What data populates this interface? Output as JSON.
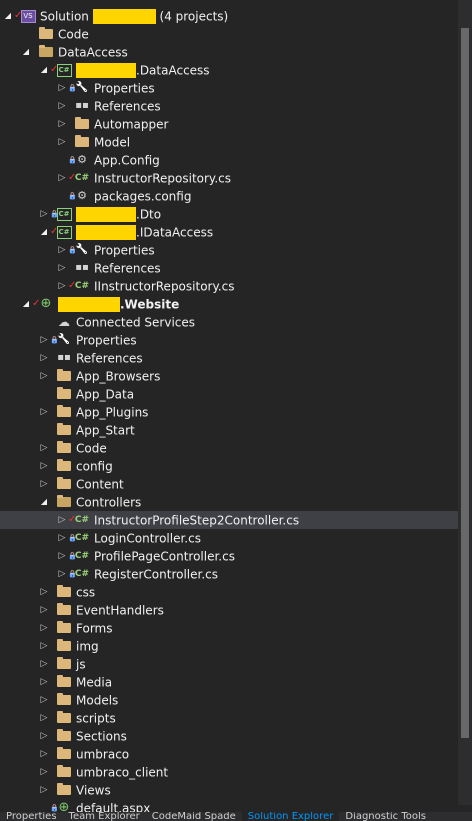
{
  "colors": {
    "background": "#252526",
    "selected_row": "#3f3f46",
    "folder": "#dcb67a",
    "csharp": "#9bd37a",
    "redaction": "#ffd500",
    "active_tab": "#0097fb"
  },
  "tree": [
    {
      "indent": 0,
      "expander": "open",
      "check": true,
      "icon": "solution-icon",
      "pre": "Solution",
      "redact_w": 63,
      "post": " (4 projects)"
    },
    {
      "indent": 1,
      "expander": "none",
      "icon": "folder-icon",
      "label": "Code"
    },
    {
      "indent": 1,
      "expander": "open",
      "icon": "folder-open-icon",
      "label": "DataAccess"
    },
    {
      "indent": 2,
      "expander": "open",
      "check": true,
      "icon": "csharp-project-icon",
      "redact_w": 60,
      "post": ".DataAccess"
    },
    {
      "indent": 3,
      "expander": "closed",
      "lock": true,
      "icon": "wrench-icon",
      "label": "Properties"
    },
    {
      "indent": 3,
      "expander": "closed",
      "icon": "references-icon",
      "label": "References"
    },
    {
      "indent": 3,
      "expander": "closed",
      "icon": "folder-icon",
      "label": "Automapper"
    },
    {
      "indent": 3,
      "expander": "closed",
      "icon": "folder-icon",
      "label": "Model"
    },
    {
      "indent": 3,
      "expander": "none",
      "lock": true,
      "icon": "config-file-icon",
      "label": "App.Config"
    },
    {
      "indent": 3,
      "expander": "closed",
      "check": true,
      "icon": "csharp-file-icon",
      "label": "InstructorRepository.cs"
    },
    {
      "indent": 3,
      "expander": "none",
      "lock": true,
      "icon": "config-file-icon",
      "label": "packages.config"
    },
    {
      "indent": 2,
      "expander": "closed",
      "lock": true,
      "icon": "csharp-project-icon",
      "redact_w": 60,
      "post": ".Dto"
    },
    {
      "indent": 2,
      "expander": "open",
      "check": true,
      "icon": "csharp-project-icon",
      "redact_w": 60,
      "post": ".IDataAccess"
    },
    {
      "indent": 3,
      "expander": "closed",
      "lock": true,
      "icon": "wrench-icon",
      "label": "Properties"
    },
    {
      "indent": 3,
      "expander": "closed",
      "icon": "references-icon",
      "label": "References"
    },
    {
      "indent": 3,
      "expander": "closed",
      "check": true,
      "icon": "csharp-file-icon",
      "label": "IInstructorRepository.cs"
    },
    {
      "indent": 1,
      "expander": "open",
      "check": true,
      "icon": "web-project-icon",
      "redact_w": 62,
      "post": ".Website",
      "bold": true
    },
    {
      "indent": 2,
      "expander": "none",
      "icon": "cloud-icon",
      "label": "Connected Services"
    },
    {
      "indent": 2,
      "expander": "closed",
      "lock": true,
      "icon": "wrench-icon",
      "label": "Properties"
    },
    {
      "indent": 2,
      "expander": "closed",
      "icon": "references-icon",
      "label": "References"
    },
    {
      "indent": 2,
      "expander": "closed",
      "icon": "folder-icon",
      "label": "App_Browsers"
    },
    {
      "indent": 2,
      "expander": "none",
      "icon": "folder-icon",
      "label": "App_Data"
    },
    {
      "indent": 2,
      "expander": "closed",
      "icon": "folder-icon",
      "label": "App_Plugins"
    },
    {
      "indent": 2,
      "expander": "none",
      "icon": "folder-icon",
      "label": "App_Start"
    },
    {
      "indent": 2,
      "expander": "closed",
      "icon": "folder-icon",
      "label": "Code"
    },
    {
      "indent": 2,
      "expander": "closed",
      "icon": "folder-icon",
      "label": "config"
    },
    {
      "indent": 2,
      "expander": "closed",
      "icon": "folder-icon",
      "label": "Content"
    },
    {
      "indent": 2,
      "expander": "open",
      "icon": "folder-open-icon",
      "label": "Controllers"
    },
    {
      "indent": 3,
      "expander": "closed",
      "check": true,
      "icon": "csharp-file-icon",
      "label": "InstructorProfileStep2Controller.cs",
      "selected": true
    },
    {
      "indent": 3,
      "expander": "closed",
      "lock": true,
      "icon": "csharp-file-icon",
      "label": "LoginController.cs"
    },
    {
      "indent": 3,
      "expander": "closed",
      "lock": true,
      "icon": "csharp-file-icon",
      "label": "ProfilePageController.cs"
    },
    {
      "indent": 3,
      "expander": "closed",
      "lock": true,
      "icon": "csharp-file-icon",
      "label": "RegisterController.cs"
    },
    {
      "indent": 2,
      "expander": "closed",
      "icon": "folder-icon",
      "label": "css"
    },
    {
      "indent": 2,
      "expander": "closed",
      "icon": "folder-icon",
      "label": "EventHandlers"
    },
    {
      "indent": 2,
      "expander": "closed",
      "icon": "folder-icon",
      "label": "Forms"
    },
    {
      "indent": 2,
      "expander": "closed",
      "icon": "folder-icon",
      "label": "img"
    },
    {
      "indent": 2,
      "expander": "closed",
      "icon": "folder-icon",
      "label": "js"
    },
    {
      "indent": 2,
      "expander": "closed",
      "icon": "folder-icon",
      "label": "Media"
    },
    {
      "indent": 2,
      "expander": "closed",
      "icon": "folder-icon",
      "label": "Models"
    },
    {
      "indent": 2,
      "expander": "closed",
      "icon": "folder-icon",
      "label": "scripts"
    },
    {
      "indent": 2,
      "expander": "closed",
      "icon": "folder-icon",
      "label": "Sections"
    },
    {
      "indent": 2,
      "expander": "closed",
      "icon": "folder-icon",
      "label": "umbraco"
    },
    {
      "indent": 2,
      "expander": "closed",
      "icon": "folder-icon",
      "label": "umbraco_client"
    },
    {
      "indent": 2,
      "expander": "closed",
      "icon": "folder-icon",
      "label": "Views"
    },
    {
      "indent": 2,
      "expander": "none",
      "lock": true,
      "icon": "aspx-file-icon",
      "label": "default.aspx"
    }
  ],
  "bottom_tabs": [
    {
      "label": "Properties",
      "active": false
    },
    {
      "label": "Team Explorer",
      "active": false
    },
    {
      "label": "CodeMaid Spade",
      "active": false
    },
    {
      "label": "Solution Explorer",
      "active": true
    },
    {
      "label": "Diagnostic Tools",
      "active": false
    }
  ]
}
